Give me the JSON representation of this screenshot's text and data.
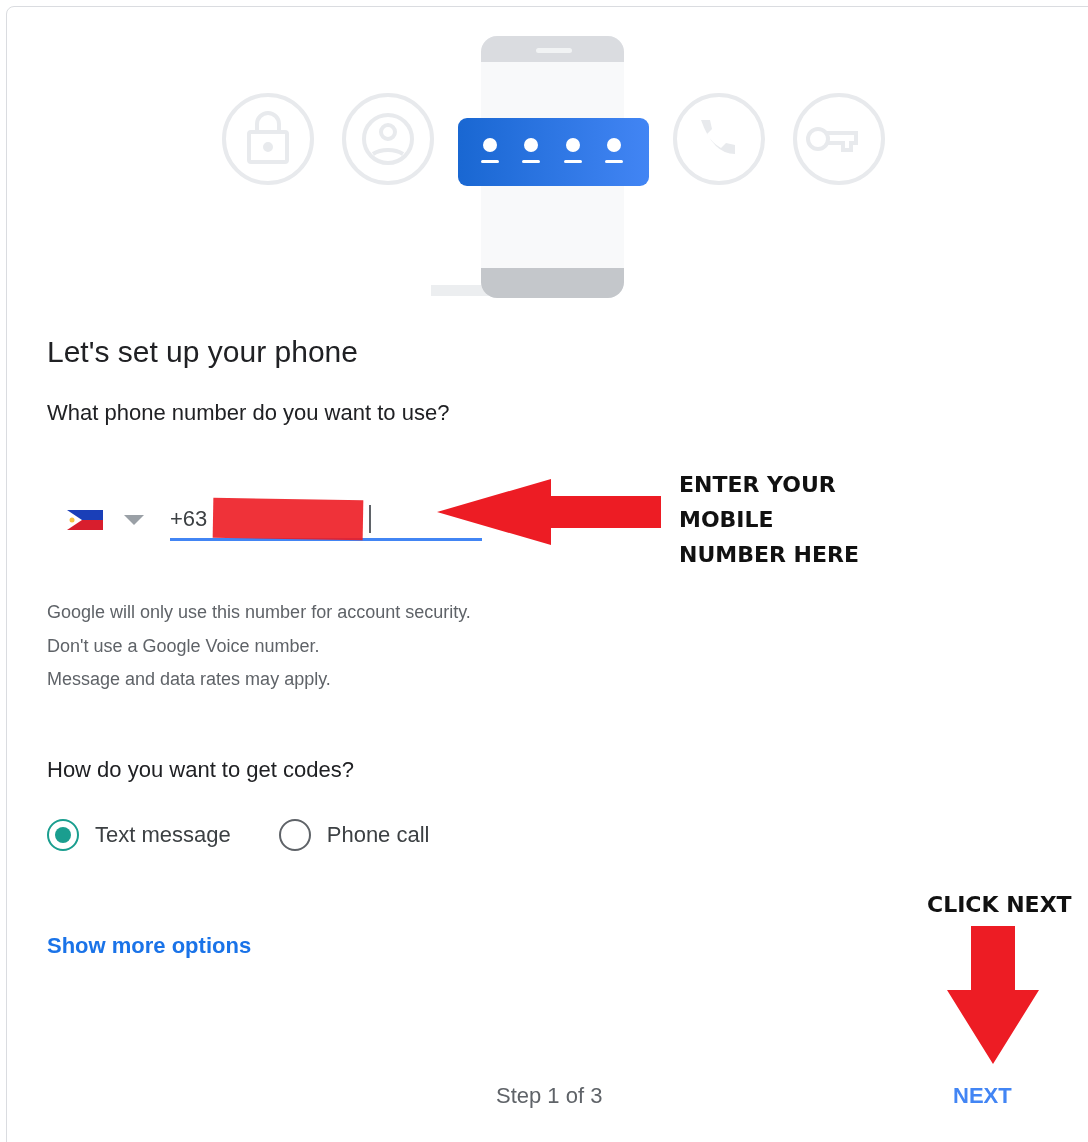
{
  "heading": "Let's set up your phone",
  "phone_question": "What phone number do you want to use?",
  "phone_field": {
    "country_code": "+63",
    "redacted": true
  },
  "helper_lines": [
    "Google will only use this number for account security.",
    "Don't use a Google Voice number.",
    "Message and data rates may apply."
  ],
  "codes_question": "How do you want to get codes?",
  "code_options": [
    {
      "label": "Text message",
      "selected": true
    },
    {
      "label": "Phone call",
      "selected": false
    }
  ],
  "show_more_link": "Show more options",
  "footer": {
    "step": "Step 1 of 3",
    "next_button": "NEXT"
  },
  "annotations": [
    {
      "kind": "left",
      "lines": [
        "ENTER YOUR",
        "MOBILE",
        "NUMBER HERE"
      ]
    },
    {
      "kind": "down",
      "lines": [
        "CLICK NEXT"
      ]
    }
  ]
}
